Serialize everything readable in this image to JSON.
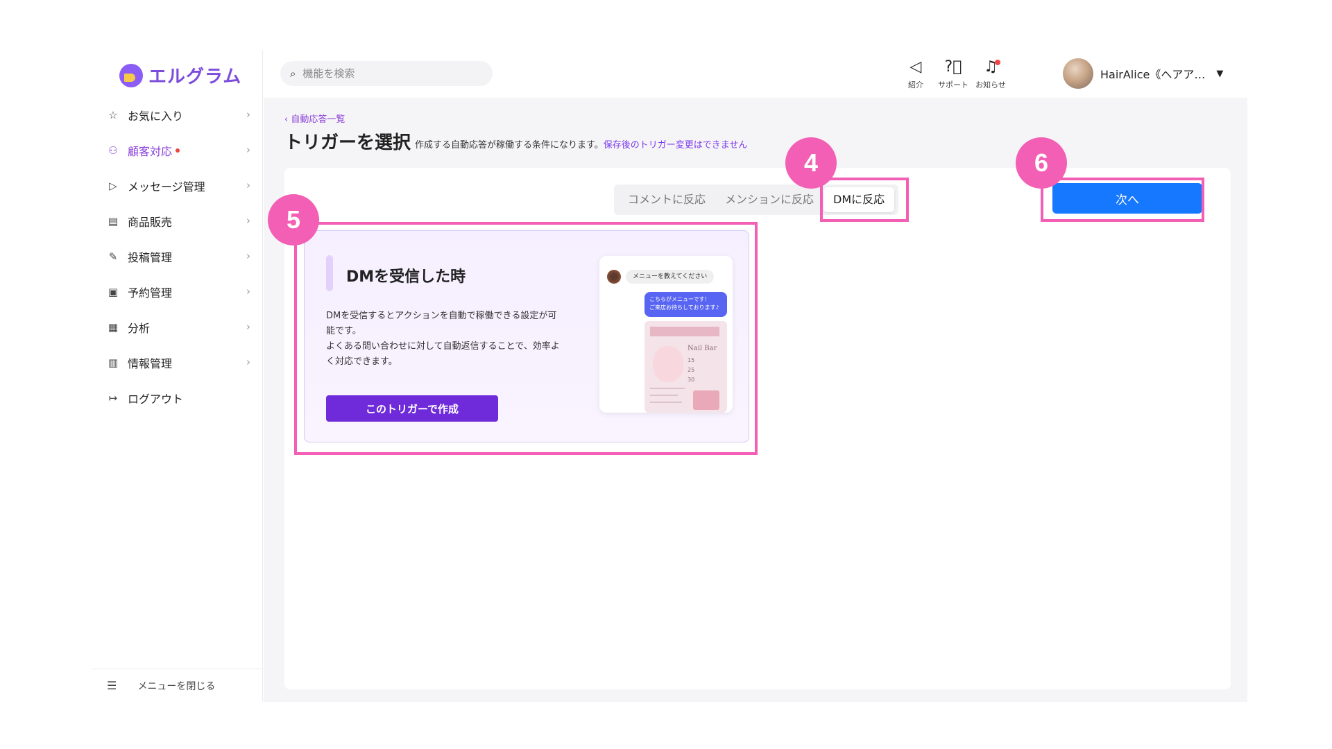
{
  "app": {
    "logo_text": "エルグラム"
  },
  "sidebar": {
    "items": [
      {
        "label": "お気に入り",
        "icon": "star-icon",
        "active": false
      },
      {
        "label": "顧客対応",
        "icon": "user-icon",
        "active": true,
        "has_dot": true
      },
      {
        "label": "メッセージ管理",
        "icon": "send-icon",
        "active": false
      },
      {
        "label": "商品販売",
        "icon": "store-icon",
        "active": false
      },
      {
        "label": "投稿管理",
        "icon": "edit-icon",
        "active": false
      },
      {
        "label": "予約管理",
        "icon": "calendar-icon",
        "active": false
      },
      {
        "label": "分析",
        "icon": "report-icon",
        "active": false
      },
      {
        "label": "情報管理",
        "icon": "bar-chart-icon",
        "active": false
      },
      {
        "label": "ログアウト",
        "icon": "logout-icon",
        "active": false
      }
    ],
    "close_menu_label": "メニューを閉じる"
  },
  "header": {
    "search_placeholder": "機能を検索",
    "icons": [
      {
        "label": "紹介",
        "icon": "megaphone-icon"
      },
      {
        "label": "サポート",
        "icon": "help-icon"
      },
      {
        "label": "お知らせ",
        "icon": "bell-icon",
        "has_dot": true
      }
    ],
    "user_name": "HairAlice《ヘアア…"
  },
  "main": {
    "back_link": "自動応答一覧",
    "title": "トリガーを選択",
    "description": "作成する自動応答が稼働する条件になります。",
    "warning": "保存後のトリガー変更はできません",
    "tabs": [
      {
        "label": "コメントに反応",
        "active": false
      },
      {
        "label": "メンションに反応",
        "active": false
      },
      {
        "label": "DMに反応",
        "active": true
      }
    ],
    "next_button": "次へ",
    "card": {
      "title": "DMを受信した時",
      "description": "DMを受信するとアクションを自動で稼働できる設定が可\n能です。\nよくある問い合わせに対して自動返信することで、効率よ\nく対応できます。",
      "button": "このトリガーで作成",
      "preview": {
        "incoming_message": "メニューを教えてください",
        "reply_message": "こちらがメニューです！\nご来店お待ちしております♪",
        "image_title": "Nail Bar",
        "prices": [
          "15",
          "25",
          "30"
        ]
      }
    }
  },
  "annotations": {
    "badges": [
      "4",
      "5",
      "6"
    ],
    "color": "#f25fb5"
  },
  "colors": {
    "brand": "#7c4ddb",
    "active_nav": "#8b3fd9",
    "primary_button": "#1677ff",
    "create_button": "#6f2bd9"
  }
}
